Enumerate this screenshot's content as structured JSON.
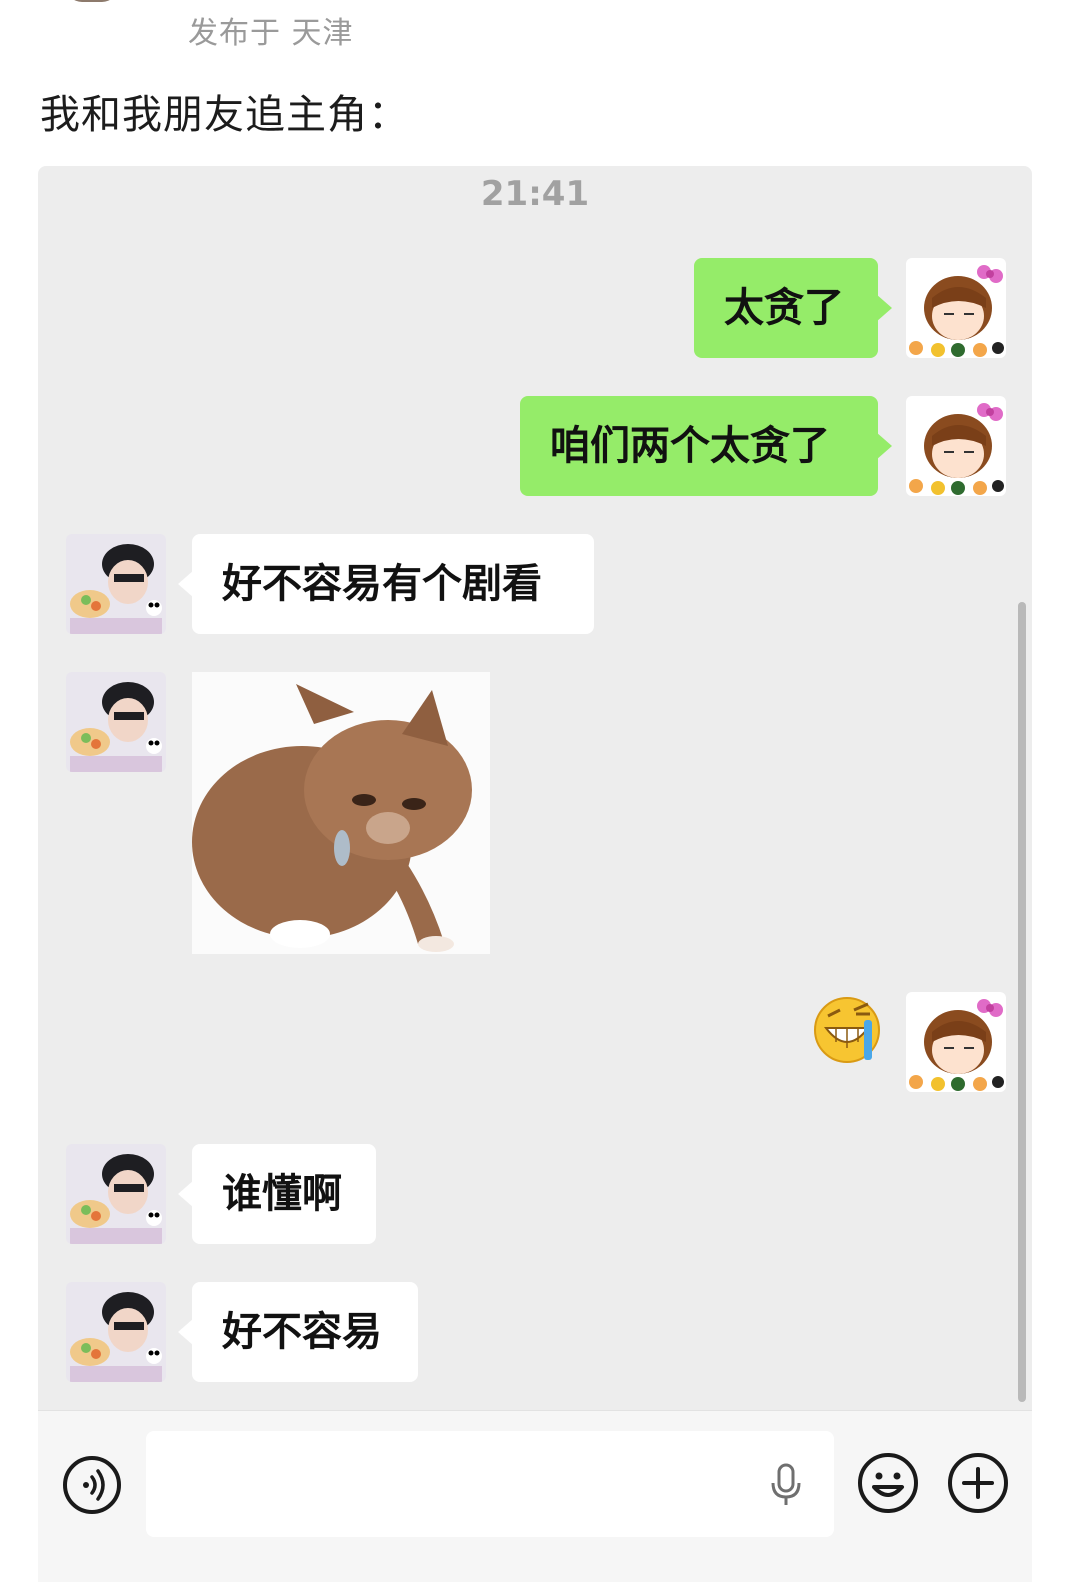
{
  "post": {
    "location": "发布于 天津",
    "text": "我和我朋友追主角："
  },
  "chat": {
    "time": "21:41",
    "messages": [
      {
        "sender": "me",
        "type": "text",
        "text": "太贪了"
      },
      {
        "sender": "me",
        "type": "text",
        "text": "咱们两个太贪了"
      },
      {
        "sender": "friend",
        "type": "text",
        "text": "好不容易有个剧看"
      },
      {
        "sender": "friend",
        "type": "sticker",
        "sticker": "sad-kitten-sticker"
      },
      {
        "sender": "me",
        "type": "emoji",
        "emoji": "grin-tears-emoji"
      },
      {
        "sender": "friend",
        "type": "text",
        "text": "谁懂啊"
      },
      {
        "sender": "friend",
        "type": "text",
        "text": "好不容易"
      }
    ]
  },
  "input_bar": {
    "icons": [
      "voice-icon",
      "microphone-icon",
      "emoji-icon",
      "plus-icon"
    ]
  },
  "colors": {
    "chat_background": "#ededed",
    "my_bubble": "#95ec69",
    "friend_bubble": "#ffffff",
    "timestamp": "#a1a1a1"
  }
}
